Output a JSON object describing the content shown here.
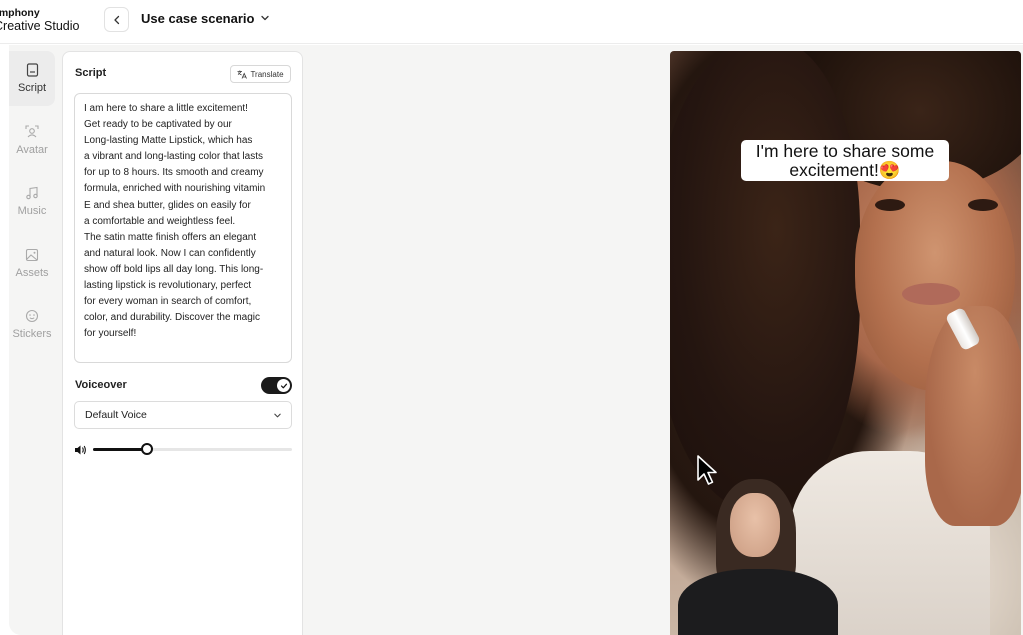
{
  "header": {
    "brand_line1": "ymphony",
    "brand_line2": "Creative Studio",
    "back_icon": "chevron-left-icon",
    "title": "Use case scenario",
    "title_chevron_icon": "chevron-down-icon"
  },
  "sidebar": {
    "items": [
      {
        "label": "Script",
        "icon": "script-icon",
        "active": true
      },
      {
        "label": "Avatar",
        "icon": "avatar-icon",
        "active": false
      },
      {
        "label": "Music",
        "icon": "music-icon",
        "active": false
      },
      {
        "label": "Assets",
        "icon": "image-icon",
        "active": false
      },
      {
        "label": "Stickers",
        "icon": "sticker-icon",
        "active": false
      }
    ]
  },
  "script_panel": {
    "title": "Script",
    "translate_label": "Translate",
    "script_text": "I am here to share a little excitement!\nGet ready to be captivated by our\nLong-lasting Matte Lipstick, which has\na vibrant and long-lasting color that lasts\nfor up to 8 hours. Its smooth and creamy\nformula, enriched with nourishing vitamin\nE and shea butter, glides on easily for\na comfortable and weightless feel.\nThe satin matte finish offers an elegant\nand natural look. Now I can confidently\nshow off bold lips all day long. This long-\nlasting lipstick is revolutionary, perfect\nfor every woman in search of comfort,\ncolor, and durability. Discover the magic\nfor yourself!",
    "voiceover_label": "Voiceover",
    "voiceover_enabled": true,
    "voice_selected": "Default Voice",
    "volume_level": 0.27
  },
  "preview": {
    "caption_text": "I'm here to share some excitement!😍"
  },
  "colors": {
    "accent": "#111111",
    "workspace_bg": "#f5f5f4"
  }
}
